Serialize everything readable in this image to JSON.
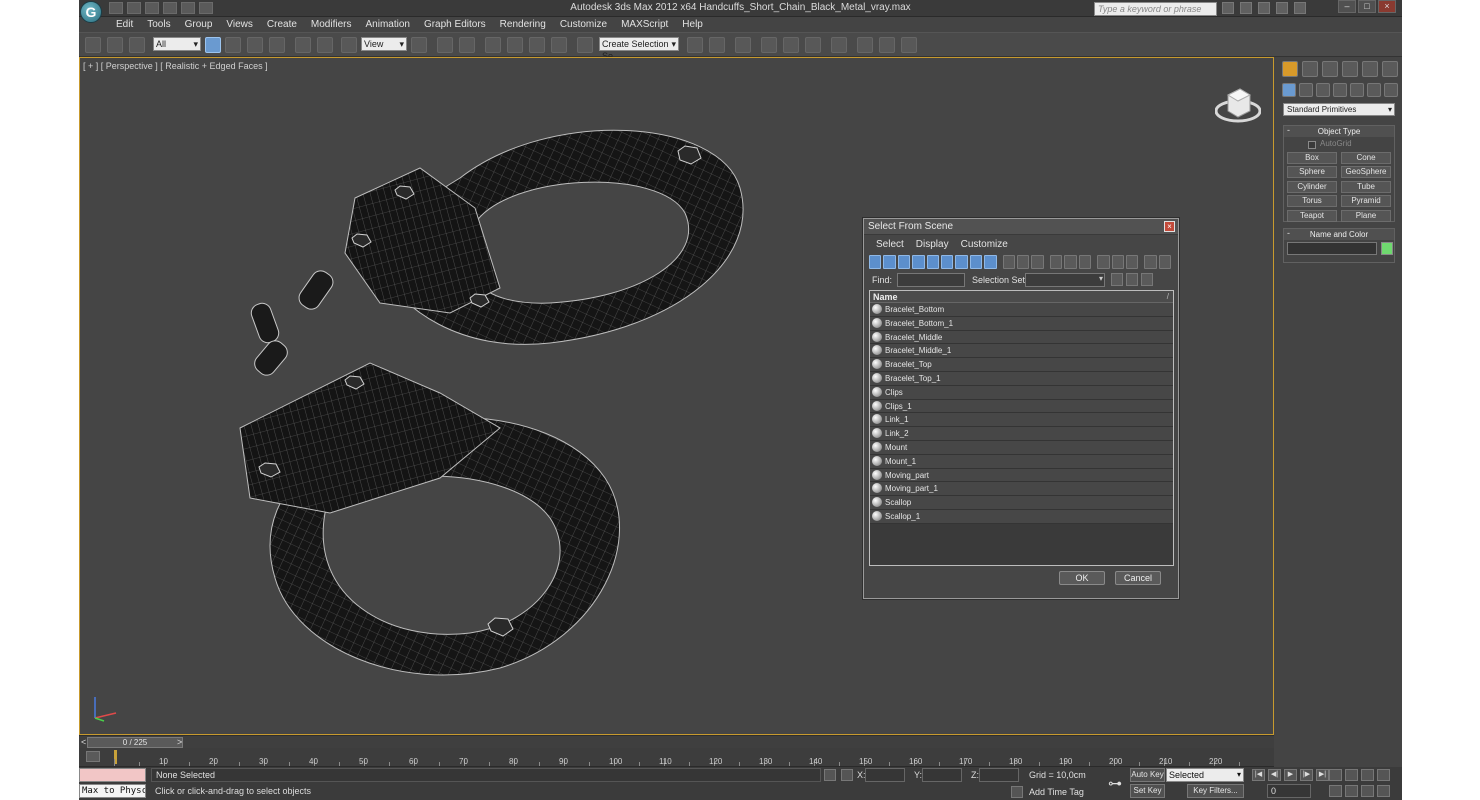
{
  "window": {
    "title": "Autodesk 3ds Max  2012 x64      Handcuffs_Short_Chain_Black_Metal_vray.max",
    "search_placeholder": "Type a keyword or phrase",
    "logo_glyph": "G"
  },
  "menu": [
    "Edit",
    "Tools",
    "Group",
    "Views",
    "Create",
    "Modifiers",
    "Animation",
    "Graph Editors",
    "Rendering",
    "Customize",
    "MAXScript",
    "Help"
  ],
  "toolbar": {
    "filter_value": "All",
    "refcoord_value": "View",
    "selection_set_placeholder": "Create Selection Se"
  },
  "viewport": {
    "label": "[ + ] [ Perspective ] [ Realistic + Edged Faces ]",
    "background": "#454545",
    "active_border": "#c79a2e"
  },
  "dialog": {
    "title": "Select From Scene",
    "menu": [
      "Select",
      "Display",
      "Customize"
    ],
    "find_label": "Find:",
    "selection_set_label": "Selection Set:",
    "column_name": "Name",
    "sort_glyph": "/",
    "close_glyph": "×",
    "items": [
      "Bracelet_Bottom",
      "Bracelet_Bottom_1",
      "Bracelet_Middle",
      "Bracelet_Middle_1",
      "Bracelet_Top",
      "Bracelet_Top_1",
      "Clips",
      "Clips_1",
      "Link_1",
      "Link_2",
      "Mount",
      "Mount_1",
      "Moving_part",
      "Moving_part_1",
      "Scallop",
      "Scallop_1"
    ],
    "ok_label": "OK",
    "cancel_label": "Cancel"
  },
  "command_panel": {
    "primitive_type": "Standard Primitives",
    "object_type_title": "Object Type",
    "autogrid_label": "AutoGrid",
    "primitives": [
      "Box",
      "Cone",
      "Sphere",
      "GeoSphere",
      "Cylinder",
      "Tube",
      "Torus",
      "Pyramid",
      "Teapot",
      "Plane"
    ],
    "name_color_title": "Name and Color",
    "object_color": "#6fd86f",
    "rollout_minus": "-"
  },
  "timeline": {
    "frame_display": "0 / 225",
    "left_arrow": "<",
    "right_arrow": ">",
    "ticks": [
      "10",
      "20",
      "30",
      "40",
      "50",
      "60",
      "70",
      "80",
      "90",
      "100",
      "110",
      "120",
      "130",
      "140",
      "150",
      "160",
      "170",
      "180",
      "190",
      "200",
      "210",
      "220"
    ]
  },
  "status": {
    "maxscript_label": "Max to Physc",
    "selection_status": "None Selected",
    "prompt": "Click or click-and-drag to select objects",
    "x_label": "X:",
    "y_label": "Y:",
    "z_label": "Z:",
    "grid": "Grid = 10,0cm",
    "add_time_tag": "Add Time Tag",
    "auto_key": "Auto Key",
    "set_key": "Set Key",
    "key_mode": "Selected",
    "key_filters": "Key Filters...",
    "current_frame": "0",
    "key_glyph": "⊶"
  }
}
